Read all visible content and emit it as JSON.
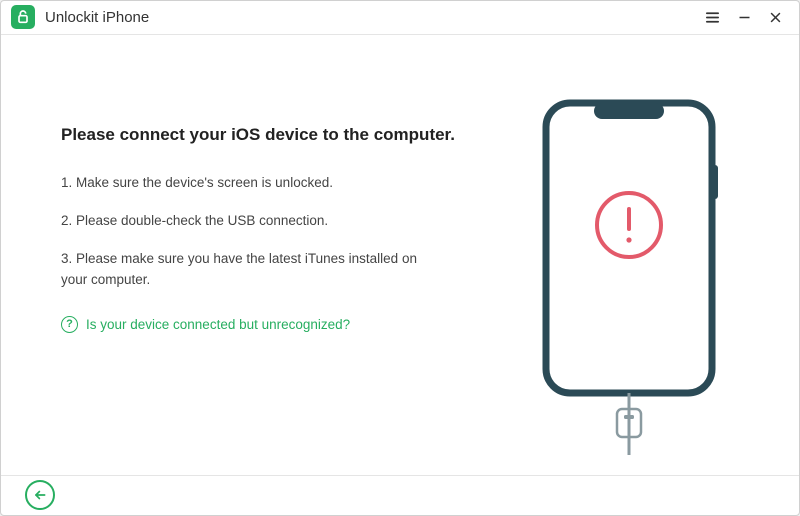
{
  "app": {
    "title": "Unlockit iPhone"
  },
  "main": {
    "heading": "Please connect your iOS device to the computer.",
    "steps": [
      "1. Make sure the device's screen is unlocked.",
      "2. Please double-check the USB connection.",
      "3. Please make sure you have the latest iTunes installed on your computer."
    ],
    "help_link": "Is your device connected but unrecognized?"
  },
  "colors": {
    "accent": "#27ae60",
    "alert": "#e35a6a",
    "device_outline": "#2b4a56"
  }
}
